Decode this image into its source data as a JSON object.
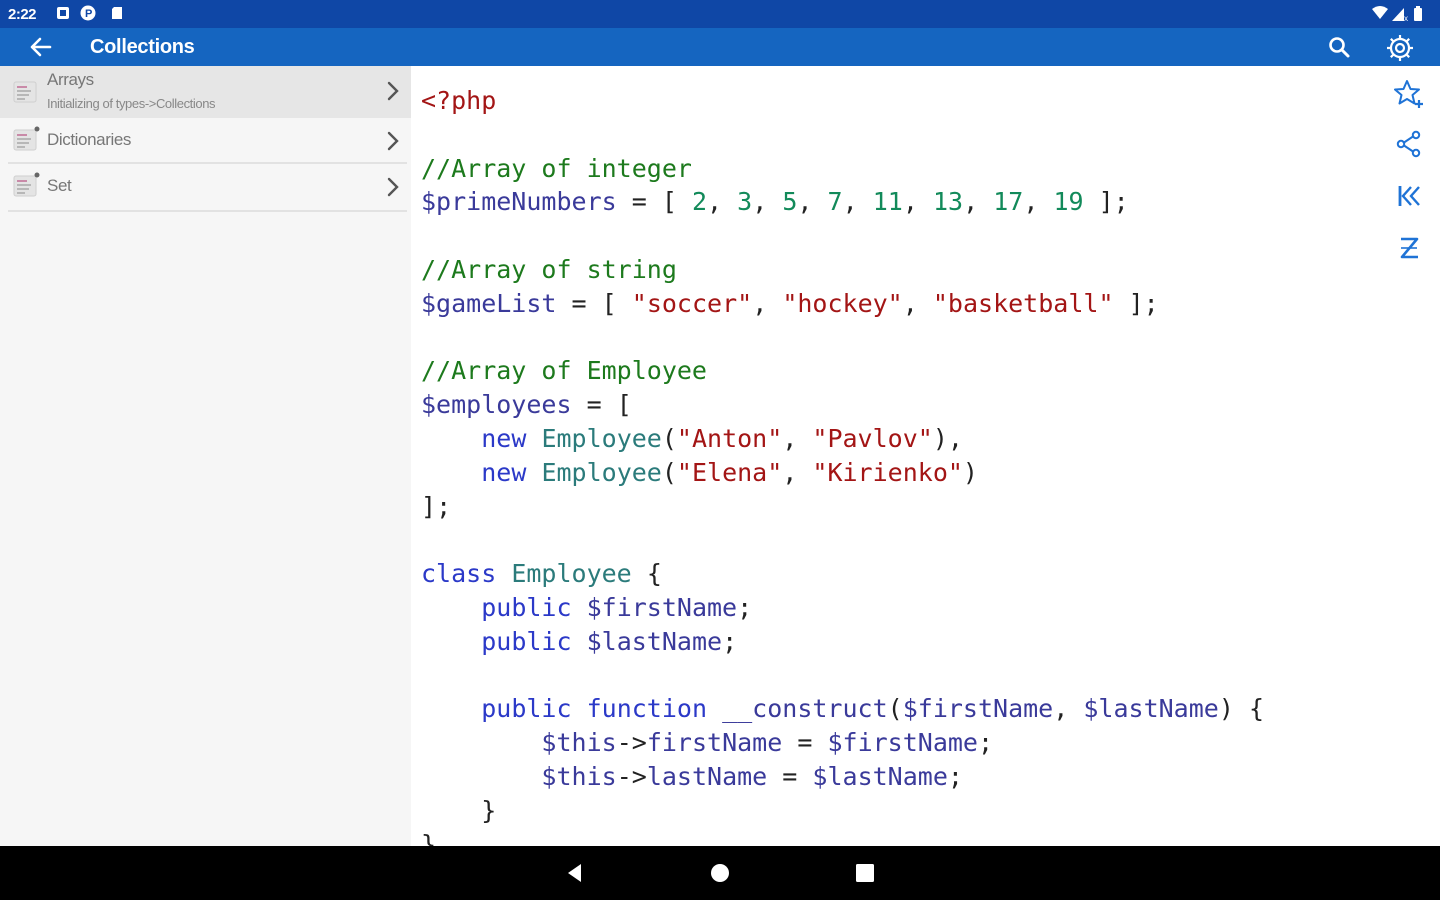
{
  "status_bar": {
    "time": "2:22",
    "icons": [
      "notification-square-icon",
      "app-p-icon",
      "sd-card-icon",
      "wifi-icon",
      "signal-icon",
      "battery-icon"
    ]
  },
  "app_bar": {
    "title": "Collections",
    "icons": [
      "back-arrow-icon",
      "search-icon",
      "settings-gear-icon"
    ]
  },
  "sidebar": {
    "items": [
      {
        "label": "Arrays",
        "subtitle": "Initializing of types->Collections",
        "selected": true
      },
      {
        "label": "Dictionaries",
        "subtitle": "",
        "selected": false
      },
      {
        "label": "Set",
        "subtitle": "",
        "selected": false
      }
    ]
  },
  "code": {
    "language": "php",
    "lines": [
      "<?php",
      "",
      "//Array of integer",
      "$primeNumbers = [ 2, 3, 5, 7, 11, 13, 17, 19 ];",
      "",
      "//Array of string",
      "$gameList = [ \"soccer\", \"hockey\", \"basketball\" ];",
      "",
      "//Array of Employee",
      "$employees = [",
      "    new Employee(\"Anton\", \"Pavlov\"),",
      "    new Employee(\"Elena\", \"Kirienko\")",
      "];",
      "",
      "class Employee {",
      "    public $firstName;",
      "    public $lastName;",
      "",
      "    public function __construct($firstName, $lastName) {",
      "        $this->firstName = $firstName;",
      "        $this->lastName = $lastName;",
      "    }",
      "}"
    ]
  },
  "right_rail": {
    "icons": [
      "favorite-star-add-icon",
      "share-icon",
      "first-page-icon",
      "zoom-z-icon"
    ]
  },
  "nav_bar": {
    "icons": [
      "nav-back-icon",
      "nav-home-icon",
      "nav-recents-icon"
    ]
  },
  "colors": {
    "status_bar": "#0f47a6",
    "app_bar": "#1565c0",
    "sidebar_bg": "#f6f6f6",
    "selected_item_bg": "#e6e6e6",
    "keyword": "#2b39c8",
    "type": "#2b7b7b",
    "string": "#a31515",
    "comment": "#1d7a1d",
    "number": "#128a5a",
    "rail_icon": "#1f73d6"
  }
}
